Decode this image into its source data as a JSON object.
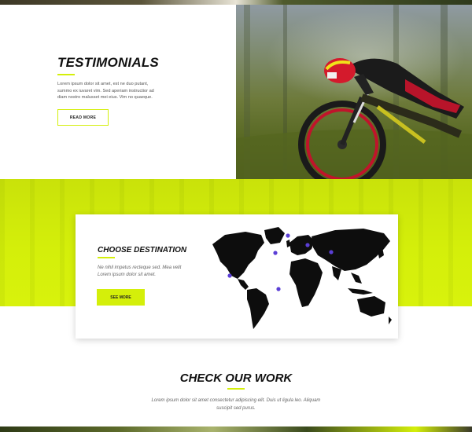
{
  "colors": {
    "accent": "#d4ef0a",
    "heading": "#111111",
    "body_text": "#666666"
  },
  "testimonials": {
    "title": "TESTIMONIALS",
    "body": "Lorem ipsum dolor sit amet, est ne duo putant, summo ex iuvaret vim. Sed aperiam instructior ad diam nostro malusset mei eius. Vim no quaeque.",
    "button_label": "READ MORE"
  },
  "destination": {
    "title": "CHOOSE DESTINATION",
    "body": "Ne nihil impetus recteque sed. Mea velit Lorem ipsum dolor sit amet.",
    "button_label": "SEE MORE",
    "map_marker_color": "#5b3fd6"
  },
  "work": {
    "title": "CHECK OUR WORK",
    "body": "Lorem ipsum dolor sit amet consectetur adipiscing elit. Duis ut ligula leo. Aliquam suscipit sed purus."
  }
}
